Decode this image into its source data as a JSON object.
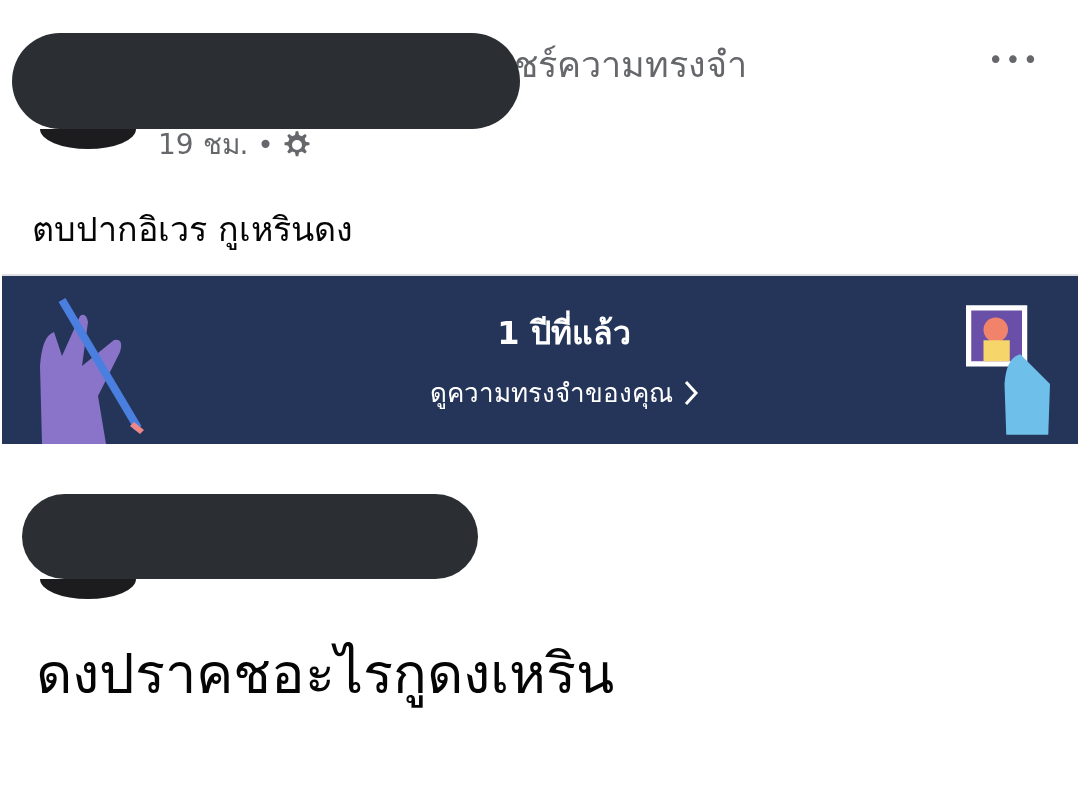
{
  "story_header": {
    "title_fragment": "ชร์ความทรงจำ",
    "time": "19 ชม. •",
    "more": "•••"
  },
  "post_text": "ตบปากอิเวร กูเหรินดง",
  "memory_banner": {
    "title": "1 ปีที่แล้ว",
    "link": "ดูความทรงจำของคุณ"
  },
  "shared_post": {
    "text": "ดงปราคชอะไรกูดงเหริน"
  }
}
